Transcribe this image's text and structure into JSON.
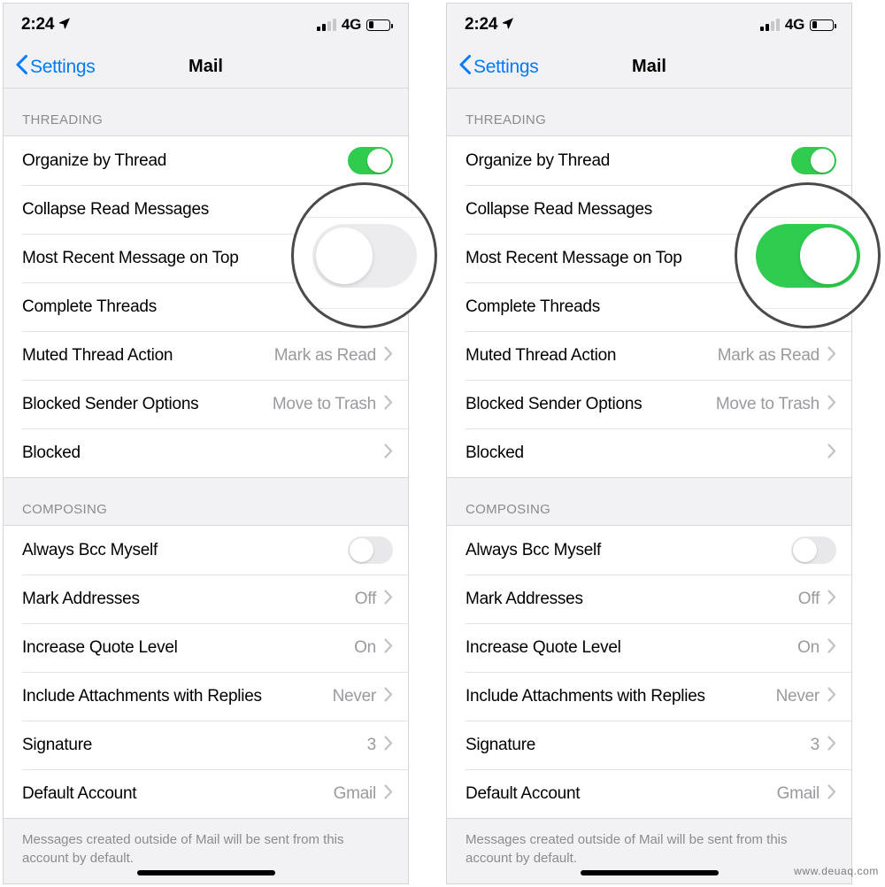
{
  "status_bar": {
    "time": "2:24",
    "location_icon": "location-arrow-icon",
    "signal_icon": "cellular-signal-icon",
    "signal_bars_filled": 2,
    "signal_bars_total": 4,
    "carrier": "4G",
    "battery_icon": "battery-icon",
    "battery_percent": 25
  },
  "nav": {
    "back_label": "Settings",
    "back_icon": "chevron-left-icon",
    "title": "Mail"
  },
  "sections": [
    {
      "header": "THREADING",
      "rows": [
        {
          "label": "Organize by Thread",
          "control": "toggle",
          "value": "",
          "toggle_on": true
        },
        {
          "label": "Collapse Read Messages",
          "control": "toggle",
          "value": "",
          "toggle_on": false
        },
        {
          "label": "Most Recent Message on Top",
          "control": "toggle",
          "value": "",
          "toggle_on": false
        },
        {
          "label": "Complete Threads",
          "control": "toggle",
          "value": "",
          "toggle_on": false
        },
        {
          "label": "Muted Thread Action",
          "control": "chevron",
          "value": "Mark as Read"
        },
        {
          "label": "Blocked Sender Options",
          "control": "chevron",
          "value": "Move to Trash"
        },
        {
          "label": "Blocked",
          "control": "chevron",
          "value": ""
        }
      ]
    },
    {
      "header": "COMPOSING",
      "rows": [
        {
          "label": "Always Bcc Myself",
          "control": "toggle",
          "value": "",
          "toggle_on": false
        },
        {
          "label": "Mark Addresses",
          "control": "chevron",
          "value": "Off"
        },
        {
          "label": "Increase Quote Level",
          "control": "chevron",
          "value": "On"
        },
        {
          "label": "Include Attachments with Replies",
          "control": "chevron",
          "value": "Never"
        },
        {
          "label": "Signature",
          "control": "chevron",
          "value": "3"
        },
        {
          "label": "Default Account",
          "control": "chevron",
          "value": "Gmail"
        }
      ]
    }
  ],
  "footer_note": "Messages created outside of Mail will be sent from this account by default.",
  "magnifier": {
    "left_state_label": "off",
    "right_state_label": "on",
    "target_row": "Most Recent Message on Top"
  },
  "watermark": "www.deuaq.com",
  "colors": {
    "toggle_on": "#2fcc4f",
    "toggle_off": "#e8e8ea",
    "accent_blue": "#007aff",
    "section_header_text": "#8b8b90",
    "group_background": "#f2f2f4"
  }
}
